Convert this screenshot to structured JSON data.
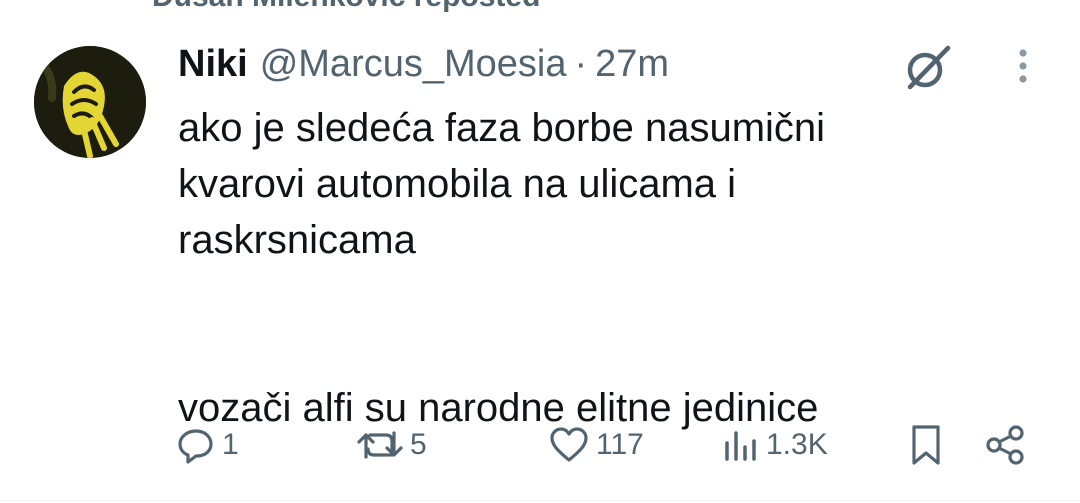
{
  "repost": {
    "text": "Dušan Milenković reposted",
    "icon": "repost-icon"
  },
  "tweet": {
    "author_name": "Niki",
    "author_handle": "@Marcus_Moesia",
    "separator": "·",
    "time": "27m",
    "text_lines": [
      "ako je sledeća faza borbe nasumični",
      "kvarovi automobila na ulicama i",
      "raskrsnicama",
      "vozači alfi su narodne elitne jedinice"
    ],
    "avatar_colors": {
      "background": "#1d1d0f",
      "accent": "#e3d634"
    }
  },
  "actions": {
    "reply_count": "1",
    "repost_count": "5",
    "like_count": "117",
    "views_count": "1.3K"
  },
  "colors": {
    "text_primary": "#0f1419",
    "text_secondary": "#536471"
  }
}
